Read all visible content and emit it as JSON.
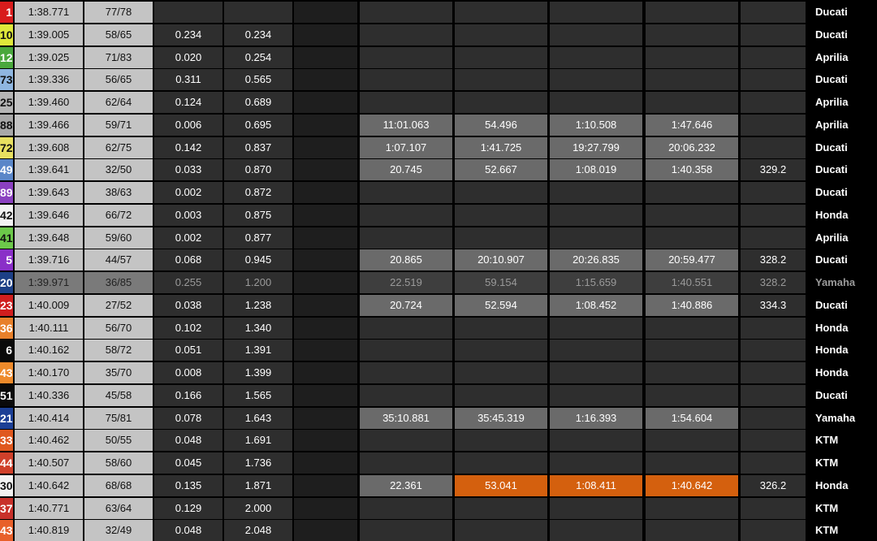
{
  "rows": [
    {
      "num": "1",
      "num_bg": "#d81c1c",
      "num_fg": "#ffffff",
      "best": "1:38.771",
      "laps": "77/78",
      "gap": "",
      "lead": "",
      "s1": "",
      "s2": "",
      "s3": "",
      "s4": "",
      "speed": "",
      "maker": "Ducati"
    },
    {
      "num": "10",
      "num_bg": "#dfe83a",
      "num_fg": "#111111",
      "best": "1:39.005",
      "laps": "58/65",
      "gap": "0.234",
      "lead": "0.234",
      "s1": "",
      "s2": "",
      "s3": "",
      "s4": "",
      "speed": "",
      "maker": "Ducati"
    },
    {
      "num": "12",
      "num_bg": "#49a83c",
      "num_fg": "#ffffff",
      "best": "1:39.025",
      "laps": "71/83",
      "gap": "0.020",
      "lead": "0.254",
      "s1": "",
      "s2": "",
      "s3": "",
      "s4": "",
      "speed": "",
      "maker": "Aprilia"
    },
    {
      "num": "73",
      "num_bg": "#8fb6e0",
      "num_fg": "#111111",
      "best": "1:39.336",
      "laps": "56/65",
      "gap": "0.311",
      "lead": "0.565",
      "s1": "",
      "s2": "",
      "s3": "",
      "s4": "",
      "speed": "",
      "maker": "Ducati"
    },
    {
      "num": "25",
      "num_bg": "#b5b5b5",
      "num_fg": "#111111",
      "best": "1:39.460",
      "laps": "62/64",
      "gap": "0.124",
      "lead": "0.689",
      "s1": "",
      "s2": "",
      "s3": "",
      "s4": "",
      "speed": "",
      "maker": "Aprilia"
    },
    {
      "num": "88",
      "num_bg": "#a8a8a8",
      "num_fg": "#111111",
      "best": "1:39.466",
      "laps": "59/71",
      "gap": "0.006",
      "lead": "0.695",
      "s1": "11:01.063",
      "s2": "54.496",
      "s3": "1:10.508",
      "s4": "1:47.646",
      "speed": "",
      "maker": "Aprilia",
      "style": "gray"
    },
    {
      "num": "72",
      "num_bg": "#e8e060",
      "num_fg": "#111111",
      "best": "1:39.608",
      "laps": "62/75",
      "gap": "0.142",
      "lead": "0.837",
      "s1": "1:07.107",
      "s2": "1:41.725",
      "s3": "19:27.799",
      "s4": "20:06.232",
      "speed": "",
      "maker": "Ducati",
      "style": "gray"
    },
    {
      "num": "49",
      "num_bg": "#5a86c8",
      "num_fg": "#ffffff",
      "best": "1:39.641",
      "laps": "32/50",
      "gap": "0.033",
      "lead": "0.870",
      "s1": "20.745",
      "s2": "52.667",
      "s3": "1:08.019",
      "s4": "1:40.358",
      "speed": "329.2",
      "maker": "Ducati",
      "style": "gray"
    },
    {
      "num": "89",
      "num_bg": "#8a40c0",
      "num_fg": "#ffffff",
      "best": "1:39.643",
      "laps": "38/63",
      "gap": "0.002",
      "lead": "0.872",
      "s1": "",
      "s2": "",
      "s3": "",
      "s4": "",
      "speed": "",
      "maker": "Ducati"
    },
    {
      "num": "42",
      "num_bg": "#f2f2f2",
      "num_fg": "#111111",
      "best": "1:39.646",
      "laps": "66/72",
      "gap": "0.003",
      "lead": "0.875",
      "s1": "",
      "s2": "",
      "s3": "",
      "s4": "",
      "speed": "",
      "maker": "Honda"
    },
    {
      "num": "41",
      "num_bg": "#6cc84a",
      "num_fg": "#111111",
      "best": "1:39.648",
      "laps": "59/60",
      "gap": "0.002",
      "lead": "0.877",
      "s1": "",
      "s2": "",
      "s3": "",
      "s4": "",
      "speed": "",
      "maker": "Aprilia"
    },
    {
      "num": "5",
      "num_bg": "#8a2fc8",
      "num_fg": "#ffffff",
      "best": "1:39.716",
      "laps": "44/57",
      "gap": "0.068",
      "lead": "0.945",
      "s1": "20.865",
      "s2": "20:10.907",
      "s3": "20:26.835",
      "s4": "20:59.477",
      "speed": "328.2",
      "maker": "Ducati",
      "style": "gray"
    },
    {
      "num": "20",
      "num_bg": "#1c3f86",
      "num_fg": "#ffffff",
      "best": "1:39.971",
      "laps": "36/85",
      "gap": "0.255",
      "lead": "1.200",
      "s1": "22.519",
      "s2": "59.154",
      "s3": "1:15.659",
      "s4": "1:40.551",
      "speed": "328.2",
      "maker": "Yamaha",
      "style": "dim"
    },
    {
      "num": "23",
      "num_bg": "#d01e1e",
      "num_fg": "#ffffff",
      "best": "1:40.009",
      "laps": "27/52",
      "gap": "0.038",
      "lead": "1.238",
      "s1": "20.724",
      "s2": "52.594",
      "s3": "1:08.452",
      "s4": "1:40.886",
      "speed": "334.3",
      "maker": "Ducati",
      "style": "gray"
    },
    {
      "num": "36",
      "num_bg": "#e8802a",
      "num_fg": "#ffffff",
      "best": "1:40.111",
      "laps": "56/70",
      "gap": "0.102",
      "lead": "1.340",
      "s1": "",
      "s2": "",
      "s3": "",
      "s4": "",
      "speed": "",
      "maker": "Honda"
    },
    {
      "num": "6",
      "num_bg": "#0a0a0a",
      "num_fg": "#ffffff",
      "best": "1:40.162",
      "laps": "58/72",
      "gap": "0.051",
      "lead": "1.391",
      "s1": "",
      "s2": "",
      "s3": "",
      "s4": "",
      "speed": "",
      "maker": "Honda"
    },
    {
      "num": "43",
      "num_bg": "#ee8a2a",
      "num_fg": "#ffffff",
      "best": "1:40.170",
      "laps": "35/70",
      "gap": "0.008",
      "lead": "1.399",
      "s1": "",
      "s2": "",
      "s3": "",
      "s4": "",
      "speed": "",
      "maker": "Honda"
    },
    {
      "num": "51",
      "num_bg": "#0a0a0a",
      "num_fg": "#ffffff",
      "best": "1:40.336",
      "laps": "45/58",
      "gap": "0.166",
      "lead": "1.565",
      "s1": "",
      "s2": "",
      "s3": "",
      "s4": "",
      "speed": "",
      "maker": "Ducati"
    },
    {
      "num": "21",
      "num_bg": "#1c3f96",
      "num_fg": "#ffffff",
      "best": "1:40.414",
      "laps": "75/81",
      "gap": "0.078",
      "lead": "1.643",
      "s1": "35:10.881",
      "s2": "35:45.319",
      "s3": "1:16.393",
      "s4": "1:54.604",
      "speed": "",
      "maker": "Yamaha",
      "style": "gray"
    },
    {
      "num": "33",
      "num_bg": "#e0581e",
      "num_fg": "#ffffff",
      "best": "1:40.462",
      "laps": "50/55",
      "gap": "0.048",
      "lead": "1.691",
      "s1": "",
      "s2": "",
      "s3": "",
      "s4": "",
      "speed": "",
      "maker": "KTM"
    },
    {
      "num": "44",
      "num_bg": "#d0402a",
      "num_fg": "#ffffff",
      "best": "1:40.507",
      "laps": "58/60",
      "gap": "0.045",
      "lead": "1.736",
      "s1": "",
      "s2": "",
      "s3": "",
      "s4": "",
      "speed": "",
      "maker": "KTM"
    },
    {
      "num": "30",
      "num_bg": "#f2f2f2",
      "num_fg": "#111111",
      "best": "1:40.642",
      "laps": "68/68",
      "gap": "0.135",
      "lead": "1.871",
      "s1": "22.361",
      "s2": "53.041",
      "s3": "1:08.411",
      "s4": "1:40.642",
      "speed": "326.2",
      "maker": "Honda",
      "style": "gray",
      "orange": [
        "s2",
        "s3",
        "s4"
      ]
    },
    {
      "num": "37",
      "num_bg": "#c8302a",
      "num_fg": "#ffffff",
      "best": "1:40.771",
      "laps": "63/64",
      "gap": "0.129",
      "lead": "2.000",
      "s1": "",
      "s2": "",
      "s3": "",
      "s4": "",
      "speed": "",
      "maker": "KTM"
    },
    {
      "num": "43",
      "num_bg": "#e8602a",
      "num_fg": "#ffffff",
      "best": "1:40.819",
      "laps": "32/49",
      "gap": "0.048",
      "lead": "2.048",
      "s1": "",
      "s2": "",
      "s3": "",
      "s4": "",
      "speed": "",
      "maker": "KTM"
    }
  ],
  "colors": {
    "highlight": "#d4600e",
    "row_bg": "#2e2e2e",
    "panel": "#c4c4c4"
  }
}
